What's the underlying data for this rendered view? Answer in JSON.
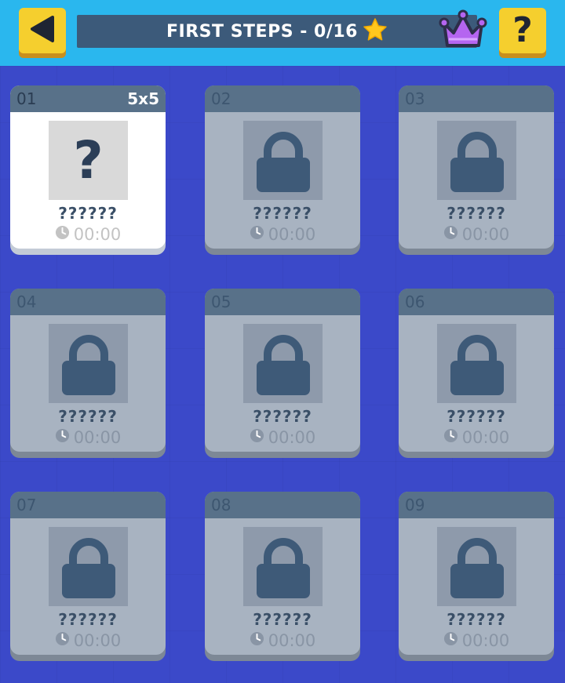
{
  "header": {
    "title": "FIRST STEPS - 0/16",
    "back_icon": "back-arrow-icon",
    "help_label": "?",
    "star_icon": "star-icon",
    "crown_icon": "crown-icon"
  },
  "colors": {
    "background": "#3b49c9",
    "topbar": "#2ab7ee",
    "button_yellow": "#f5cf2e",
    "title_bar": "#3c5a7a",
    "card_locked": "#a8b3c1",
    "card_header": "#587189",
    "lock": "#3e5a78",
    "crown": "#b565f0",
    "star": "#ffc81e"
  },
  "levels": [
    {
      "number": "01",
      "size": "5x5",
      "name": "??????",
      "time": "00:00",
      "locked": false,
      "thumb_text": "?"
    },
    {
      "number": "02",
      "size": "",
      "name": "??????",
      "time": "00:00",
      "locked": true
    },
    {
      "number": "03",
      "size": "",
      "name": "??????",
      "time": "00:00",
      "locked": true
    },
    {
      "number": "04",
      "size": "",
      "name": "??????",
      "time": "00:00",
      "locked": true
    },
    {
      "number": "05",
      "size": "",
      "name": "??????",
      "time": "00:00",
      "locked": true
    },
    {
      "number": "06",
      "size": "",
      "name": "??????",
      "time": "00:00",
      "locked": true
    },
    {
      "number": "07",
      "size": "",
      "name": "??????",
      "time": "00:00",
      "locked": true
    },
    {
      "number": "08",
      "size": "",
      "name": "??????",
      "time": "00:00",
      "locked": true
    },
    {
      "number": "09",
      "size": "",
      "name": "??????",
      "time": "00:00",
      "locked": true
    }
  ]
}
